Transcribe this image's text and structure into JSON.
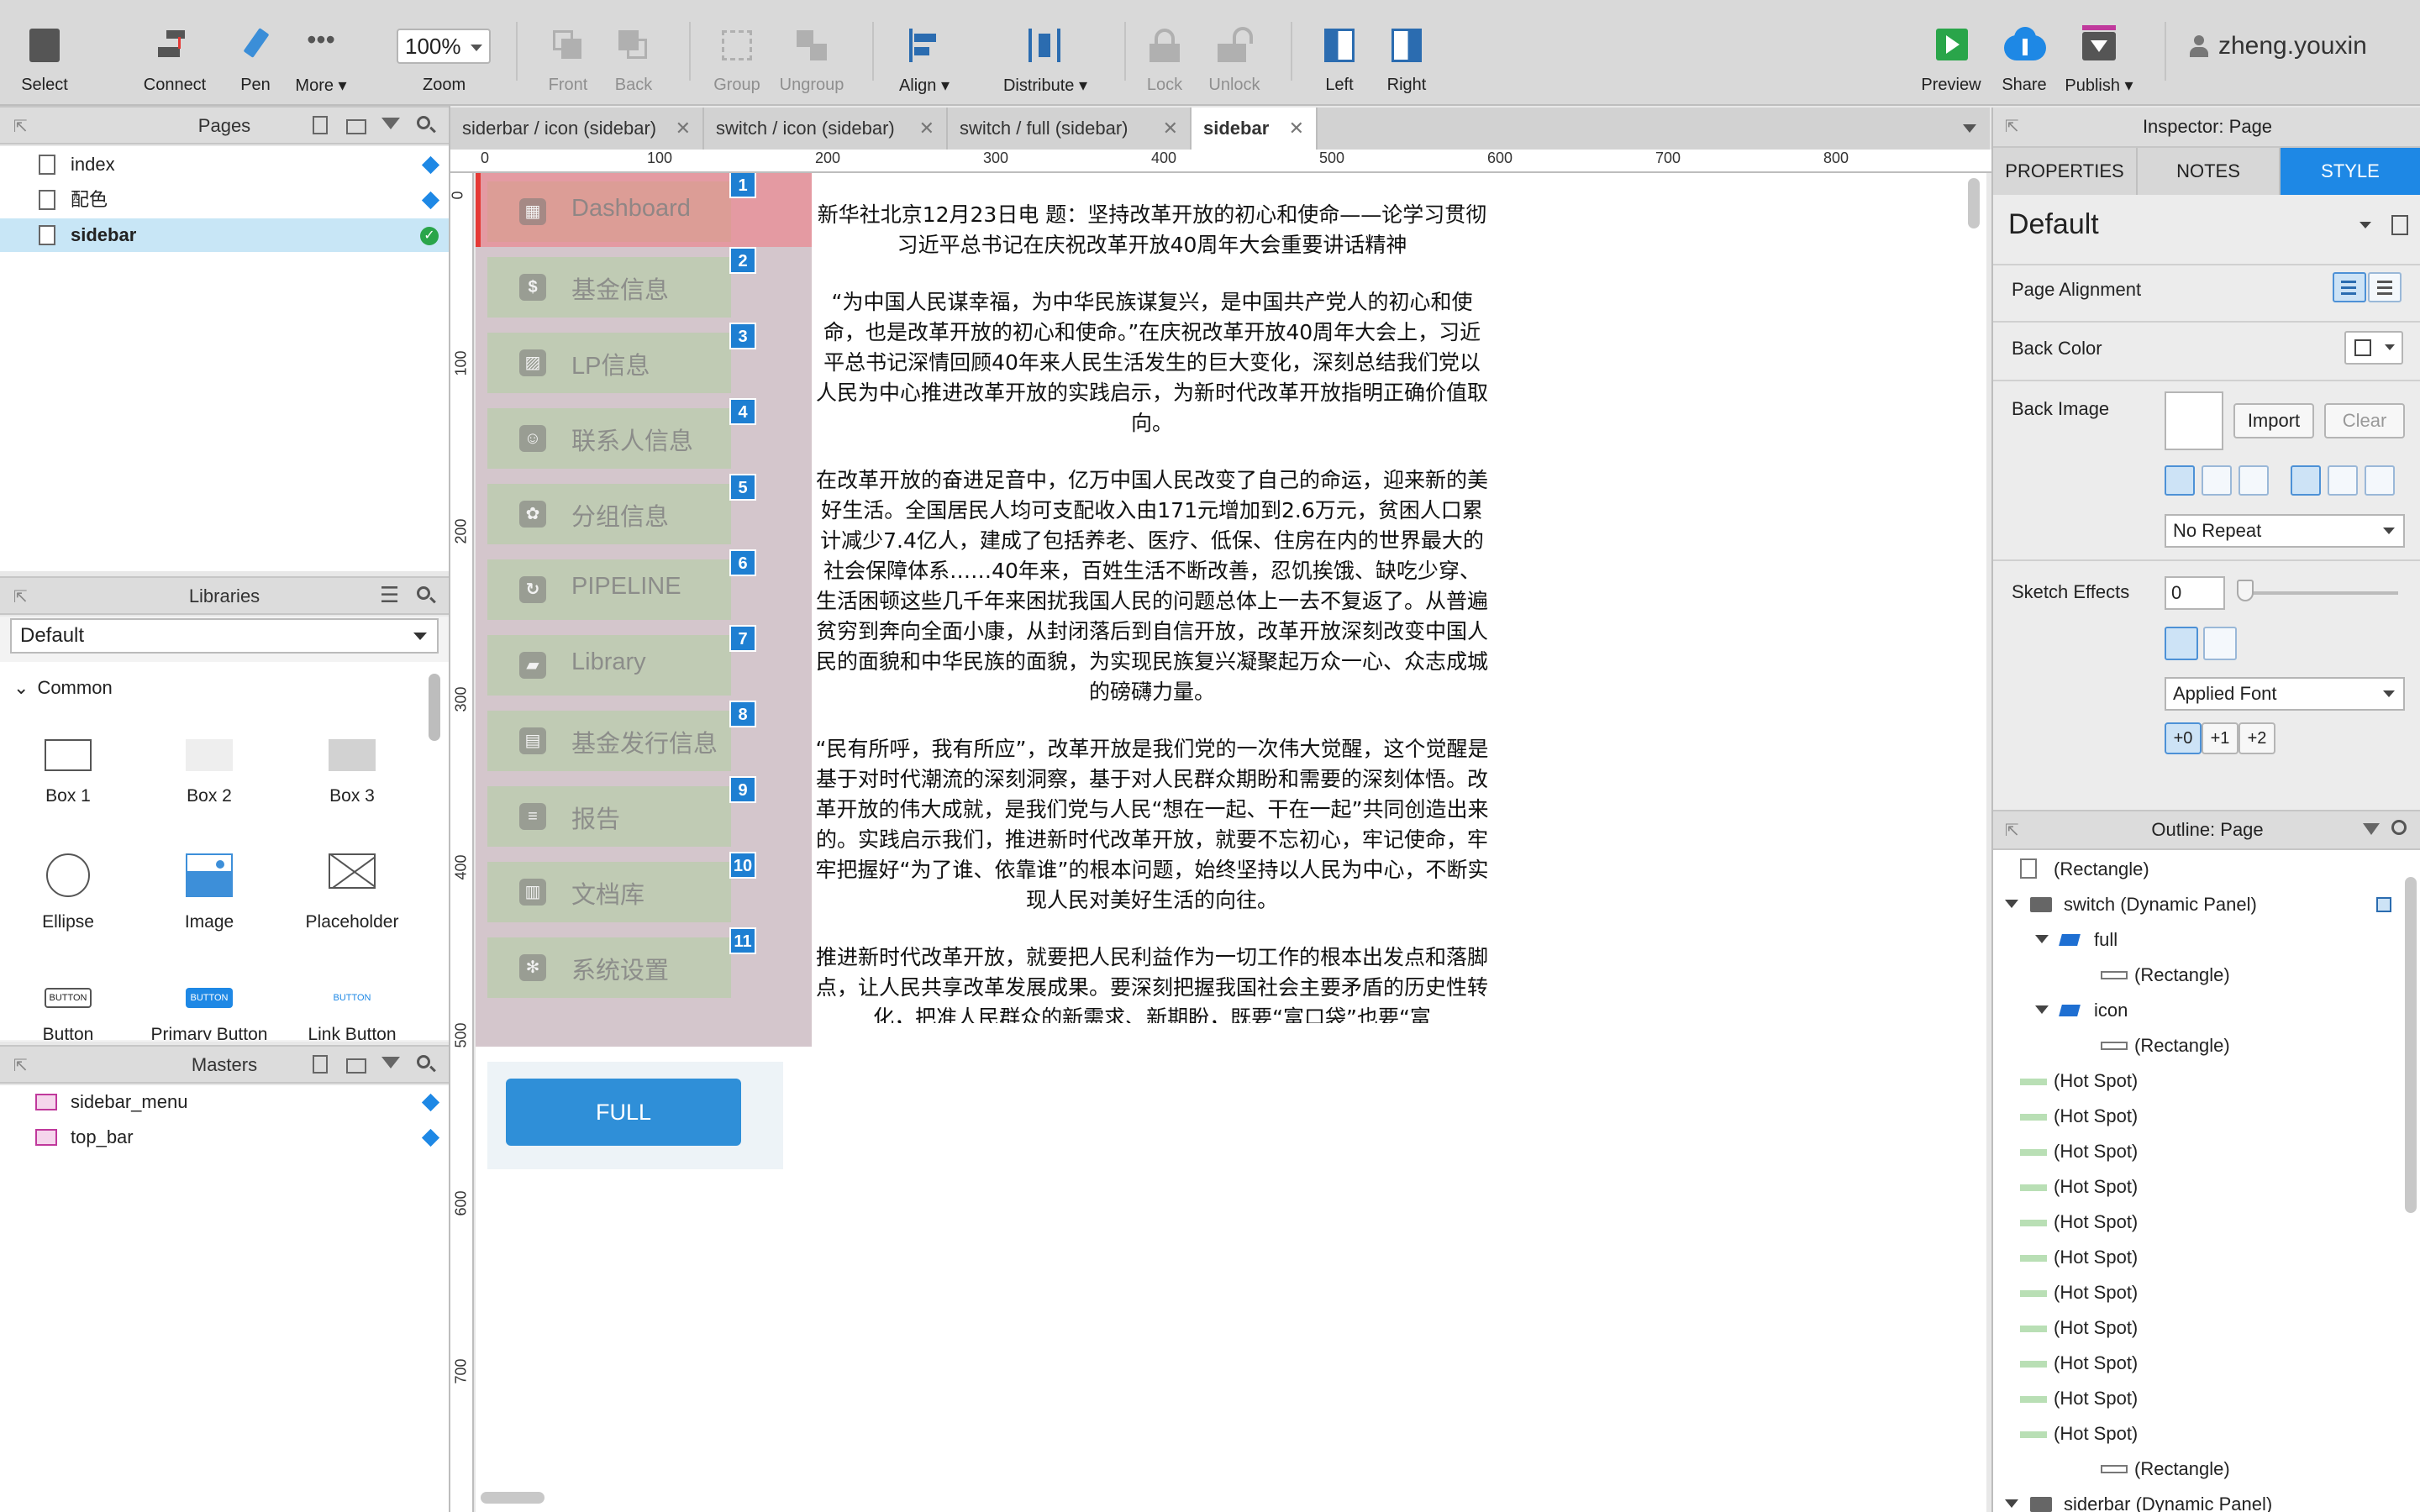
{
  "toolbar": {
    "buttons": [
      {
        "label": "Select",
        "icon": "select-icon"
      },
      {
        "label": "Connect",
        "icon": "connect-icon"
      },
      {
        "label": "Pen",
        "icon": "pen-icon"
      },
      {
        "label": "More ▾",
        "icon": "more-icon"
      },
      {
        "label": "Zoom",
        "icon": "zoom-icon"
      },
      {
        "label": "Front",
        "icon": "front-icon"
      },
      {
        "label": "Back",
        "icon": "back-icon"
      },
      {
        "label": "Group",
        "icon": "group-icon"
      },
      {
        "label": "Ungroup",
        "icon": "ungroup-icon"
      },
      {
        "label": "Align ▾",
        "icon": "align-icon"
      },
      {
        "label": "Distribute ▾",
        "icon": "distribute-icon"
      },
      {
        "label": "Lock",
        "icon": "lock-icon"
      },
      {
        "label": "Unlock",
        "icon": "unlock-icon"
      },
      {
        "label": "Left",
        "icon": "left-panel-icon"
      },
      {
        "label": "Right",
        "icon": "right-panel-icon"
      },
      {
        "label": "Preview",
        "icon": "preview-icon"
      },
      {
        "label": "Share",
        "icon": "share-icon"
      },
      {
        "label": "Publish ▾",
        "icon": "publish-icon"
      }
    ],
    "zoom_value": "100%",
    "user_name": "zheng.youxin",
    "colors": {
      "accent": "#1e88e5",
      "preview": "#2aa54a",
      "publish": "#c0399c"
    }
  },
  "pages_panel": {
    "title": "Pages",
    "items": [
      {
        "label": "index",
        "badge": "diamond"
      },
      {
        "label": "配色",
        "badge": "diamond"
      },
      {
        "label": "sidebar",
        "badge": "check",
        "selected": true
      }
    ]
  },
  "libraries_panel": {
    "title": "Libraries",
    "selected_library": "Default",
    "group": "Common",
    "widgets": [
      {
        "label": "Box 1"
      },
      {
        "label": "Box 2"
      },
      {
        "label": "Box 3"
      },
      {
        "label": "Ellipse"
      },
      {
        "label": "Image"
      },
      {
        "label": "Placeholder"
      },
      {
        "label": "Button",
        "preview": "BUTTON"
      },
      {
        "label": "Primary Button",
        "preview": "BUTTON"
      },
      {
        "label": "Link Button",
        "preview": "BUTTON"
      }
    ]
  },
  "masters_panel": {
    "title": "Masters",
    "items": [
      {
        "label": "sidebar_menu"
      },
      {
        "label": "top_bar"
      }
    ]
  },
  "tabs": [
    {
      "label": "siderbar / icon (sidebar)"
    },
    {
      "label": "switch / icon (sidebar)"
    },
    {
      "label": "switch / full (sidebar)"
    },
    {
      "label": "sidebar",
      "active": true
    }
  ],
  "ruler": {
    "top": [
      "0",
      "100",
      "200",
      "300",
      "400",
      "500",
      "600",
      "700",
      "800"
    ],
    "left": [
      "0",
      "100",
      "200",
      "300",
      "400",
      "500",
      "600",
      "700"
    ]
  },
  "canvas": {
    "menu": [
      {
        "label": "Dashboard",
        "badge": "1",
        "icon": "dashboard-icon",
        "glyph": "▦",
        "active": true
      },
      {
        "label": "基金信息",
        "badge": "2",
        "icon": "dollar-icon",
        "glyph": "$"
      },
      {
        "label": "LP信息",
        "badge": "3",
        "icon": "image-icon",
        "glyph": "▨"
      },
      {
        "label": "联系人信息",
        "badge": "4",
        "icon": "contact-icon",
        "glyph": "☺"
      },
      {
        "label": "分组信息",
        "badge": "5",
        "icon": "group-info-icon",
        "glyph": "✿"
      },
      {
        "label": "PIPELINE",
        "badge": "6",
        "icon": "refresh-icon",
        "glyph": "↻"
      },
      {
        "label": "Library",
        "badge": "7",
        "icon": "library-icon",
        "glyph": "▰"
      },
      {
        "label": "基金发行信息",
        "badge": "8",
        "icon": "clipboard-icon",
        "glyph": "▤"
      },
      {
        "label": "报告",
        "badge": "9",
        "icon": "report-icon",
        "glyph": "≡"
      },
      {
        "label": "文档库",
        "badge": "10",
        "icon": "docs-icon",
        "glyph": "▥"
      },
      {
        "label": "系统设置",
        "badge": "11",
        "icon": "settings-icon",
        "glyph": "✻"
      }
    ],
    "full_button_label": "FULL",
    "article": [
      "新华社北京12月23日电 题：坚持改革开放的初心和使命——论学习贯彻习近平总书记在庆祝改革开放40周年大会重要讲话精神",
      "“为中国人民谋幸福，为中华民族谋复兴，是中国共产党人的初心和使命，也是改革开放的初心和使命。”在庆祝改革开放40周年大会上，习近平总书记深情回顾40年来人民生活发生的巨大变化，深刻总结我们党以人民为中心推进改革开放的实践启示，为新时代改革开放指明正确价值取向。",
      "在改革开放的奋进足音中，亿万中国人民改变了自己的命运，迎来新的美好生活。全国居民人均可支配收入由171元增加到2.6万元，贫困人口累计减少7.4亿人，建成了包括养老、医疗、低保、住房在内的世界最大的社会保障体系……40年来，百姓生活不断改善，忍饥挨饿、缺吃少穿、生活困顿这些几千年来困扰我国人民的问题总体上一去不复返了。从普遍贫穷到奔向全面小康，从封闭落后到自信开放，改革开放深刻改变中国人民的面貌和中华民族的面貌，为实现民族复兴凝聚起万众一心、众志成城的磅礴力量。",
      "“民有所呼，我有所应”，改革开放是我们党的一次伟大觉醒，这个觉醒是基于对时代潮流的深刻洞察，基于对人民群众期盼和需要的深刻体悟。改革开放的伟大成就，是我们党与人民“想在一起、干在一起”共同创造出来的。实践启示我们，推进新时代改革开放，就要不忘初心，牢记使命，牢牢把握好“为了谁、依靠谁”的根本问题，始终坚持以人民为中心，不断实现人民对美好生活的向往。",
      "推进新时代改革开放，就要把人民利益作为一切工作的根本出发点和落脚点，让人民共享改革发展成果。要深刻把握我国社会主要矛盾的历史性转化，把准人民群众的新需求、新期盼，既要“富口袋”也要“富"
    ]
  },
  "inspector": {
    "title": "Inspector: Page",
    "tabs": [
      "PROPERTIES",
      "NOTES",
      "STYLE"
    ],
    "active_tab": "STYLE",
    "style_name": "Default",
    "page_alignment_label": "Page Alignment",
    "back_color_label": "Back Color",
    "back_image_label": "Back Image",
    "import_label": "Import",
    "clear_label": "Clear",
    "repeat_value": "No Repeat",
    "sketch_label": "Sketch Effects",
    "sketch_value": "0",
    "font_value": "Applied Font",
    "font_steps": [
      "+0",
      "+1",
      "+2"
    ]
  },
  "outline": {
    "title": "Outline: Page",
    "rows": [
      {
        "label": "(Rectangle)",
        "kind": "rect"
      },
      {
        "label": "switch (Dynamic Panel)",
        "kind": "dp",
        "expanded": true
      },
      {
        "label": "full",
        "kind": "state",
        "expanded": true
      },
      {
        "label": "(Rectangle)",
        "kind": "line"
      },
      {
        "label": "icon",
        "kind": "state",
        "expanded": true
      },
      {
        "label": "(Rectangle)",
        "kind": "line"
      },
      {
        "label": "(Hot Spot)",
        "kind": "hot"
      },
      {
        "label": "(Hot Spot)",
        "kind": "hot"
      },
      {
        "label": "(Hot Spot)",
        "kind": "hot"
      },
      {
        "label": "(Hot Spot)",
        "kind": "hot"
      },
      {
        "label": "(Hot Spot)",
        "kind": "hot"
      },
      {
        "label": "(Hot Spot)",
        "kind": "hot"
      },
      {
        "label": "(Hot Spot)",
        "kind": "hot"
      },
      {
        "label": "(Hot Spot)",
        "kind": "hot"
      },
      {
        "label": "(Hot Spot)",
        "kind": "hot"
      },
      {
        "label": "(Hot Spot)",
        "kind": "hot"
      },
      {
        "label": "(Hot Spot)",
        "kind": "hot"
      },
      {
        "label": "(Rectangle)",
        "kind": "line"
      },
      {
        "label": "siderbar (Dynamic Panel)",
        "kind": "dp",
        "expanded": true
      }
    ]
  }
}
